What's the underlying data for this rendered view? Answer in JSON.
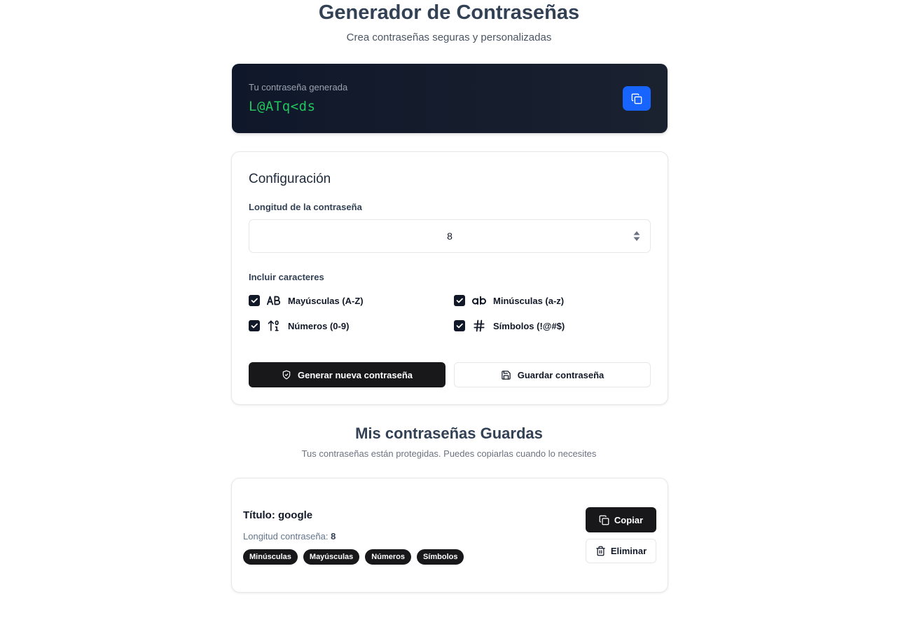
{
  "header": {
    "title": "Generador de Contraseñas",
    "subtitle": "Crea contraseñas seguras y personalizadas"
  },
  "result": {
    "label": "Tu contraseña generada",
    "password": "L@ATq<ds",
    "copy_icon": "copy-icon",
    "accent_color": "#1764ff",
    "password_color": "#22c55e"
  },
  "config": {
    "title": "Configuración",
    "length_label": "Longitud de la contraseña",
    "length_value": "8",
    "include_label": "Incluir caracteres",
    "options": [
      {
        "label": "Mayúsculas (A-Z)",
        "icon": "AB",
        "checked": true
      },
      {
        "label": "Minúsculas (a-z)",
        "icon": "ab",
        "checked": true
      },
      {
        "label": "Números (0-9)",
        "icon": "arrow-up-01-icon",
        "checked": true
      },
      {
        "label": "Símbolos (!@#$)",
        "icon": "hash-icon",
        "checked": true
      }
    ],
    "generate_label": "Generar nueva contraseña",
    "save_label": "Guardar contraseña"
  },
  "saved": {
    "title": "Mis contraseñas Guardas",
    "subtitle": "Tus contraseñas están protegidas. Puedes copiarlas cuando lo necesites",
    "items": [
      {
        "title": "Título: google",
        "length_label": "Longitud contraseña:",
        "length_value": "8",
        "tags": [
          "Minúsculas",
          "Mayúsculas",
          "Números",
          "Símbolos"
        ],
        "copy_label": "Copiar",
        "delete_label": "Eliminar"
      }
    ]
  }
}
